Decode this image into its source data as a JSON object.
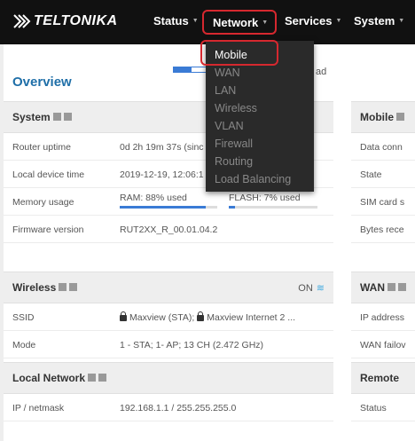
{
  "brand": {
    "name": "TELTONIKA"
  },
  "nav": {
    "status": "Status",
    "network": "Network",
    "services": "Services",
    "system": "System"
  },
  "dropdown": [
    "Mobile",
    "WAN",
    "LAN",
    "Wireless",
    "VLAN",
    "Firewall",
    "Routing",
    "Load Balancing"
  ],
  "page": {
    "title": "Overview"
  },
  "system": {
    "title": "System",
    "load_label": "ad",
    "rows": {
      "uptime": {
        "label": "Router uptime",
        "value": "0d 2h 19m 37s (sinc"
      },
      "time": {
        "label": "Local device time",
        "value": "2019-12-19, 12:06:1"
      },
      "memory": {
        "label": "Memory usage",
        "ram": "RAM: 88% used",
        "flash": "FLASH: 7% used",
        "ram_pct": 88,
        "flash_pct": 7
      },
      "firmware": {
        "label": "Firmware version",
        "value": "RUT2XX_R_00.01.04.2"
      }
    }
  },
  "wireless": {
    "title": "Wireless",
    "state": "ON",
    "rows": {
      "ssid": {
        "label": "SSID",
        "value1": "Maxview (STA);",
        "value2": "Maxview Internet 2 ..."
      },
      "mode": {
        "label": "Mode",
        "value": "1 - STA; 1- AP; 13 CH (2.472 GHz)"
      }
    }
  },
  "local_network": {
    "title": "Local Network",
    "rows": {
      "ip": {
        "label": "IP / netmask",
        "value": "192.168.1.1 / 255.255.255.0"
      }
    }
  },
  "mobile": {
    "title": "Mobile",
    "rows": [
      "Data conn",
      "State",
      "SIM card s",
      "Bytes rece"
    ]
  },
  "wan": {
    "title": "WAN",
    "rows": [
      "IP address",
      "WAN failov"
    ]
  },
  "remote": {
    "title": "Remote",
    "rows": [
      "Status"
    ]
  },
  "colors": {
    "accent": "#1f6fa8",
    "highlight": "#d6282f",
    "bar": "#3a7bd5"
  }
}
